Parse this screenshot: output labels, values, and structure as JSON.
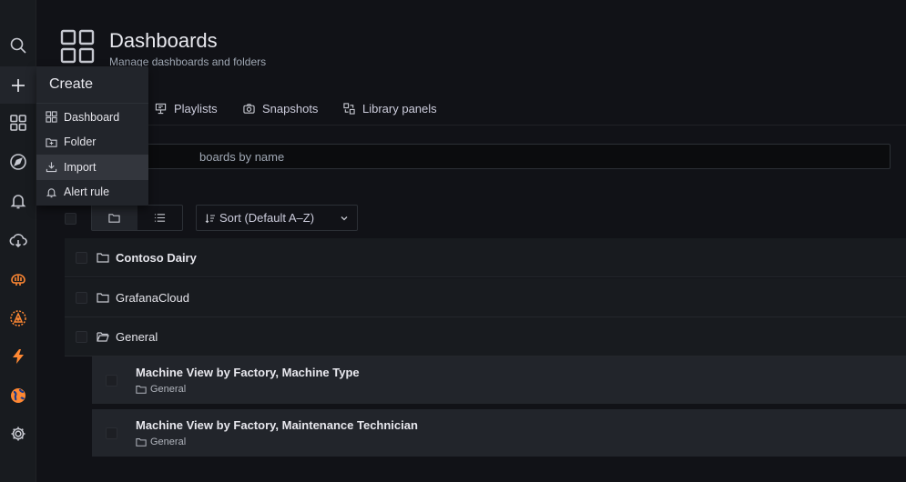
{
  "sidebar": {
    "icons": [
      "search-icon",
      "plus-icon",
      "dashboards-icon",
      "explore-icon",
      "alerting-icon",
      "cloud-icon",
      "brain-icon",
      "alert-app-icon",
      "lightning-icon",
      "globe-icon",
      "gear-icon"
    ]
  },
  "header": {
    "title": "Dashboards",
    "subtitle": "Manage dashboards and folders"
  },
  "tabs": [
    {
      "label": "Playlists",
      "icon": "presentation-icon"
    },
    {
      "label": "Snapshots",
      "icon": "camera-icon"
    },
    {
      "label": "Library panels",
      "icon": "library-icon"
    }
  ],
  "search": {
    "visible_text": "boards by name"
  },
  "toolbar": {
    "sort_label": "Sort (Default A–Z)"
  },
  "folders": [
    {
      "name": "Contoso Dairy",
      "bold": true
    },
    {
      "name": "GrafanaCloud",
      "bold": false
    },
    {
      "name": "General",
      "bold": false
    }
  ],
  "dashboards": [
    {
      "title": "Machine View by Factory, Machine Type",
      "folder": "General"
    },
    {
      "title": "Machine View by Factory, Maintenance Technician",
      "folder": "General"
    }
  ],
  "create_menu": {
    "title": "Create",
    "items": [
      {
        "label": "Dashboard",
        "icon": "dashboard-icon"
      },
      {
        "label": "Folder",
        "icon": "folder-plus-icon"
      },
      {
        "label": "Import",
        "icon": "import-icon"
      },
      {
        "label": "Alert rule",
        "icon": "bell-icon"
      }
    ]
  },
  "colors": {
    "background": "#111217",
    "panel": "#181b1f",
    "accent_orange": "#ff8833",
    "row_hover": "#22252b"
  }
}
